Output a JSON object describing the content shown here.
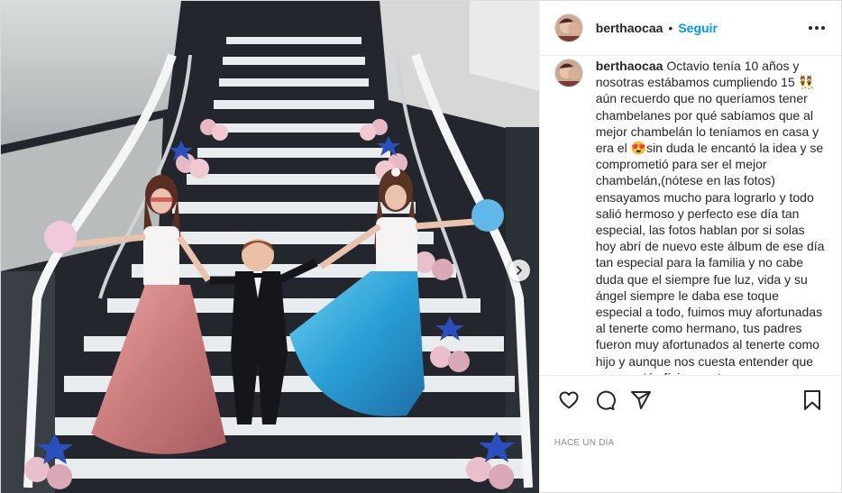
{
  "post": {
    "username": "berthaocaa",
    "separator": "•",
    "follow_label": "Seguir",
    "caption_username": "berthaocaa",
    "caption_text": "Octavio tenía 10 años y nosotras estábamos cumpliendo 15 👯 aún recuerdo que no queríamos tener chambelanes por qué sabíamos que al mejor chambelán lo teníamos en casa y era el 😍sin duda le encantó la idea y se comprometió para ser el mejor chambelán,(nótese en las fotos) ensayamos mucho para lograrlo y todo salió hermoso y perfecto ese día tan especial, las fotos hablan por si solas hoy abrí de nuevo este álbum de ese día tan especial para la familia y no cabe duda que el siempre fue luz, vida y su ángel siempre le daba ese toque especial a todo, fuimos muy afortunadas al tenerte como hermano, tus padres fueron muy afortunados al tenerte como hijo y aunque nos cuesta entender que ya no estés físicamente",
    "timestamp": "Hace un día"
  },
  "icons": {
    "more": "more-options-icon",
    "next": "chevron-right-icon",
    "like": "heart-icon",
    "comment": "comment-icon",
    "share": "paper-plane-icon",
    "save": "bookmark-icon"
  },
  "colors": {
    "accent": "#0095f6",
    "text": "#262626",
    "muted": "#8e8e8e",
    "border": "#dbdbdb"
  }
}
